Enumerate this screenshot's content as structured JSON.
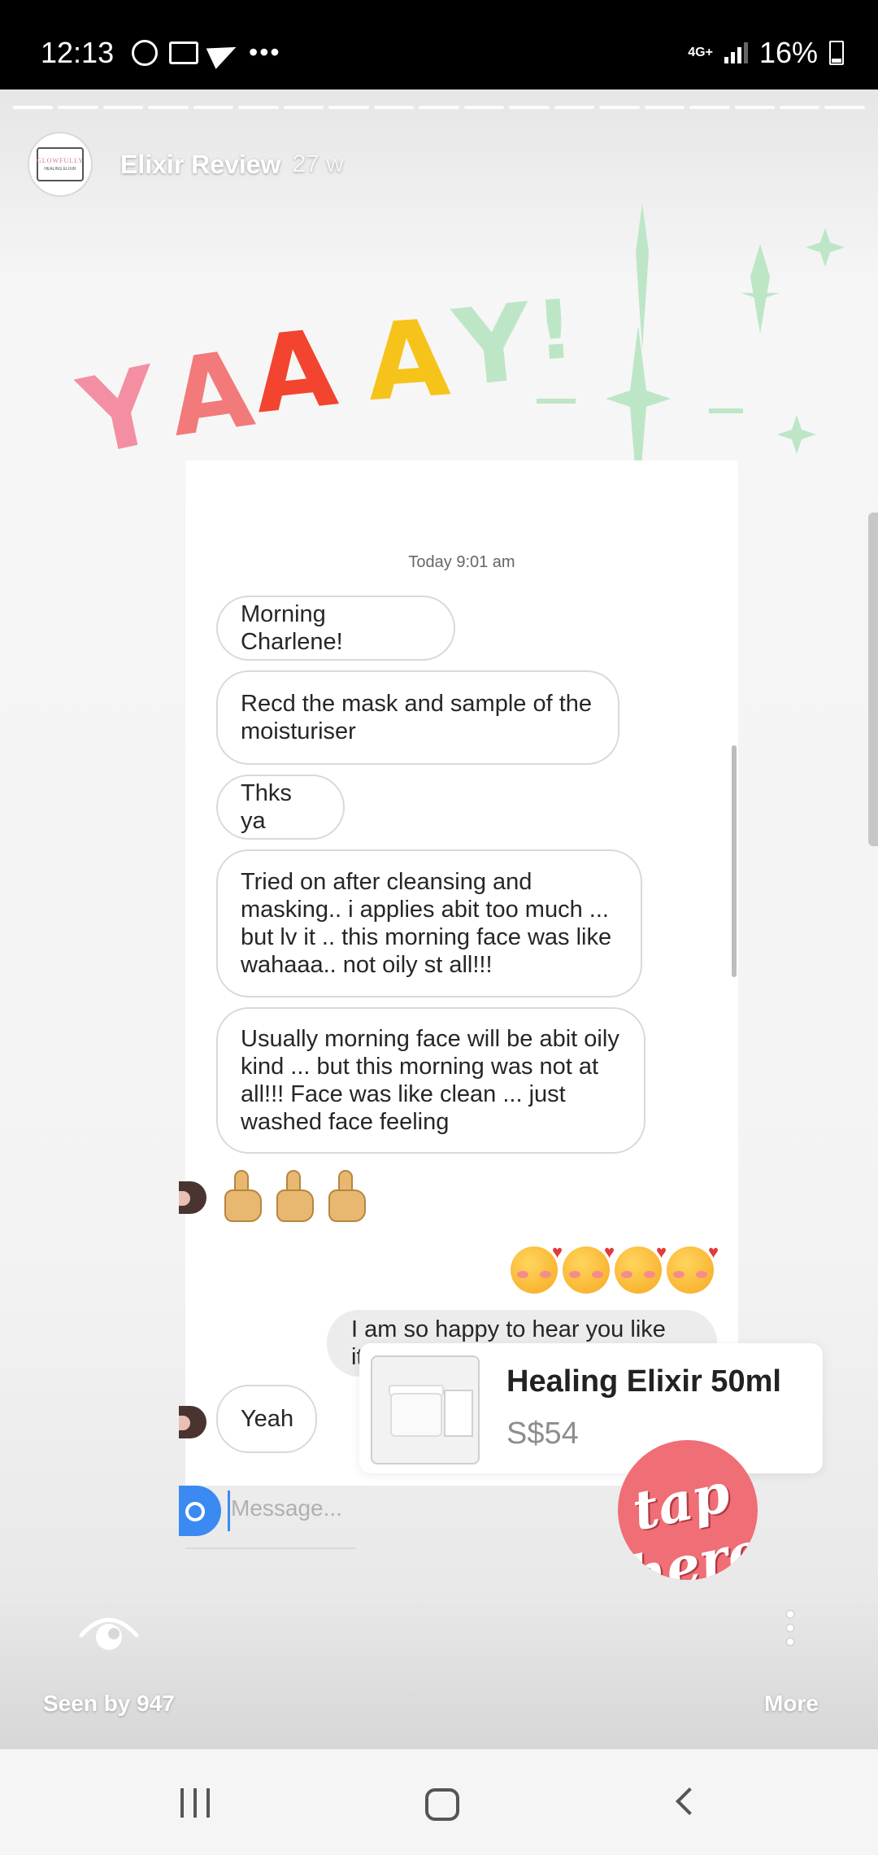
{
  "status_bar": {
    "time": "12:13",
    "network": "4G+",
    "battery": "16%",
    "notification_icons": [
      "whatsapp-icon",
      "gmail-icon",
      "telegram-icon",
      "more-icon"
    ]
  },
  "story": {
    "account_name": "Elixir Review",
    "age": "27 w",
    "avatar_brand": "GLOWFULLY",
    "avatar_sub": "HEALING ELIXIR",
    "progress_segments": 19,
    "active_segment": 0,
    "sticker_text": "YAAAY!",
    "sticker_colors": [
      "#f48fa3",
      "#f27a7a",
      "#f2442e",
      "#f6c31b",
      "#bde6c6",
      "#bde6c6"
    ],
    "tap_sticker_text": "tap here"
  },
  "chat": {
    "timestamp": "Today 9:01 am",
    "messages": [
      {
        "side": "left",
        "text": "Morning Charlene!"
      },
      {
        "side": "left",
        "text": "Recd the mask and sample of the moisturiser"
      },
      {
        "side": "left",
        "text": "Thks ya"
      },
      {
        "side": "left",
        "text": "Tried on after cleansing and masking.. i applies abit too much ... but lv it .. this morning face was like wahaaa.. not oily st all!!!"
      },
      {
        "side": "left",
        "text": "Usually morning face will be abit oily kind ... but this morning was not at all!!! Face was like clean ... just washed face feeling"
      },
      {
        "side": "left",
        "emoji": "thumbs-up x3"
      },
      {
        "side": "right",
        "emoji": "smiling-face-with-hearts x4"
      },
      {
        "side": "right",
        "text": "I am so happy to hear you like it!!"
      },
      {
        "side": "left",
        "text": "Yeah"
      }
    ],
    "composer_placeholder": "Message..."
  },
  "product": {
    "name": "Healing Elixir 50ml",
    "price": "S$54"
  },
  "footer": {
    "seen_by": "Seen by 947",
    "more": "More"
  }
}
